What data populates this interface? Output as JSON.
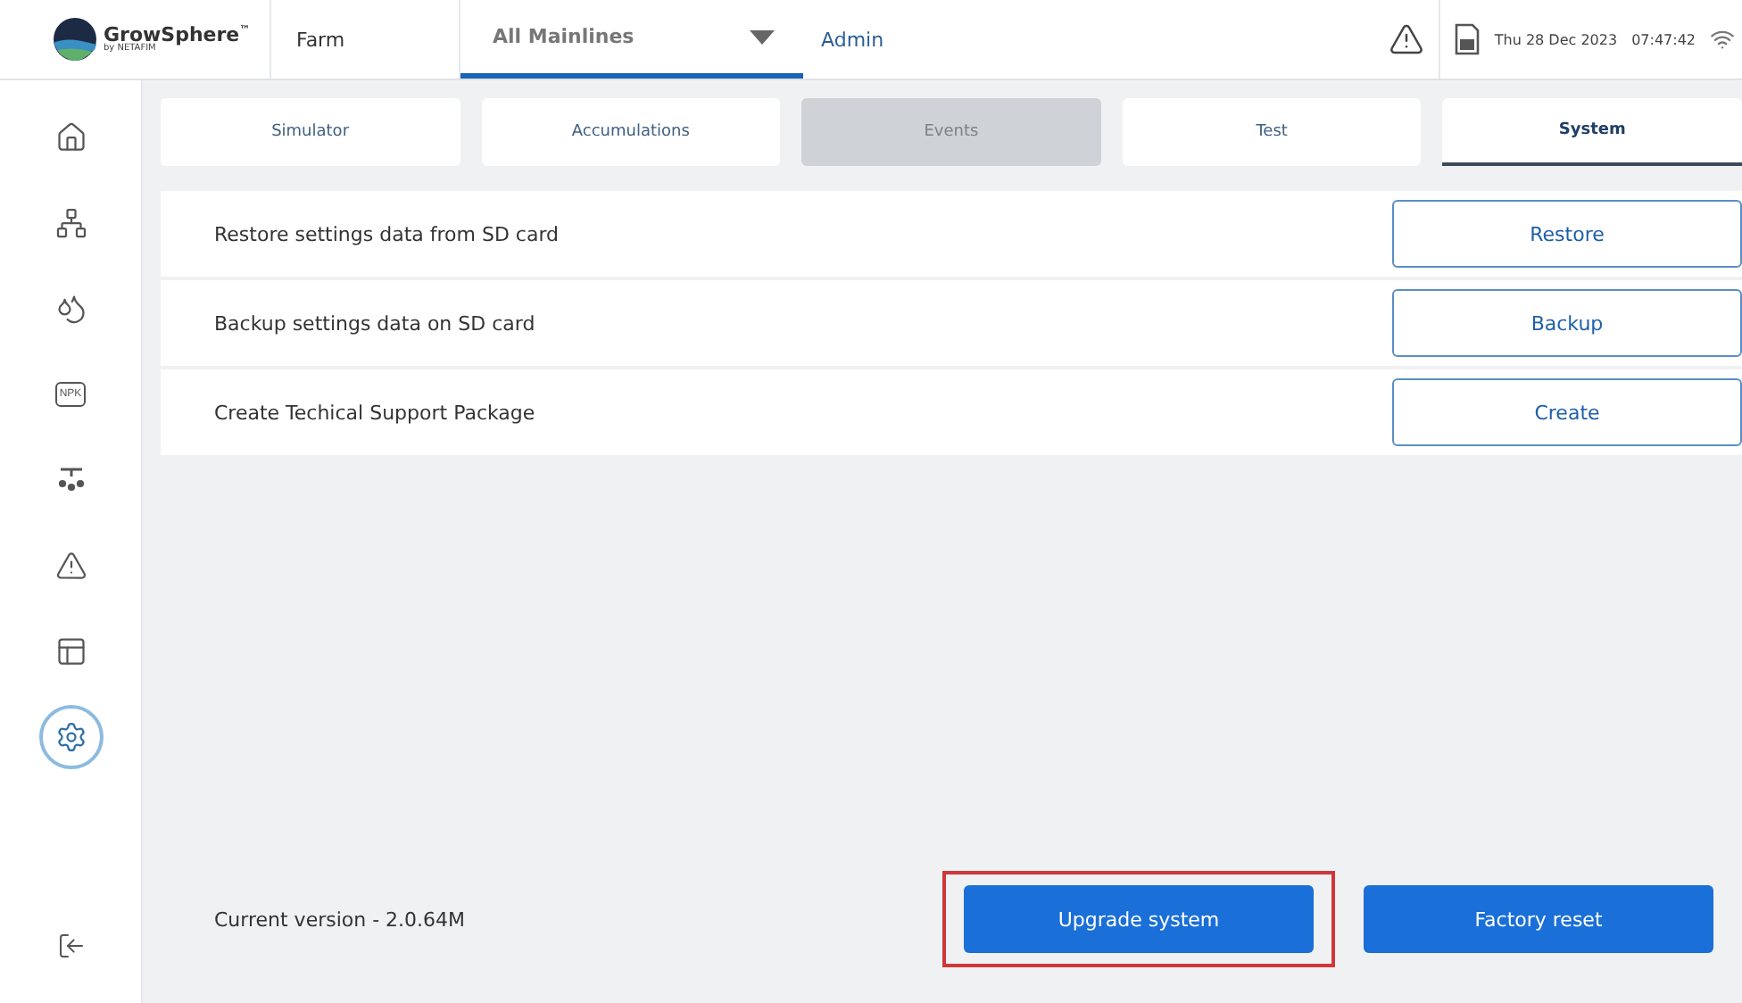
{
  "header": {
    "brand": "GrowSphere",
    "brand_mark": "™",
    "brand_sub": "by NETAFIM",
    "site": "Farm",
    "mainline_select": {
      "value": "All Mainlines"
    },
    "user": "Admin",
    "date": "Thu 28 Dec 2023",
    "time": "07:47:42"
  },
  "sidebar": {
    "items": [
      {
        "kind": "home",
        "selected": false
      },
      {
        "kind": "hierarchy",
        "selected": false
      },
      {
        "kind": "drops",
        "selected": false
      },
      {
        "kind": "npk",
        "label": "NPK",
        "selected": false
      },
      {
        "kind": "sprinkler",
        "selected": false
      },
      {
        "kind": "alert",
        "selected": false
      },
      {
        "kind": "layout",
        "selected": false
      },
      {
        "kind": "settings",
        "selected": true
      }
    ],
    "footer": {
      "kind": "logout"
    }
  },
  "tabs": [
    {
      "label": "Simulator",
      "selected": false,
      "disabled": false
    },
    {
      "label": "Accumulations",
      "selected": false,
      "disabled": false
    },
    {
      "label": "Events",
      "selected": false,
      "disabled": true
    },
    {
      "label": "Test",
      "selected": false,
      "disabled": false
    },
    {
      "label": "System",
      "selected": true,
      "disabled": false
    }
  ],
  "actions": [
    {
      "label": "Restore settings data from SD card",
      "button": "Restore"
    },
    {
      "label": "Backup settings data on SD card",
      "button": "Backup"
    },
    {
      "label": "Create Techical Support Package",
      "button": "Create"
    }
  ],
  "footer": {
    "version": "Current version - 2.0.64M",
    "buttons": [
      {
        "label": "Upgrade system",
        "highlighted": true
      },
      {
        "label": "Factory reset",
        "highlighted": false
      }
    ]
  }
}
